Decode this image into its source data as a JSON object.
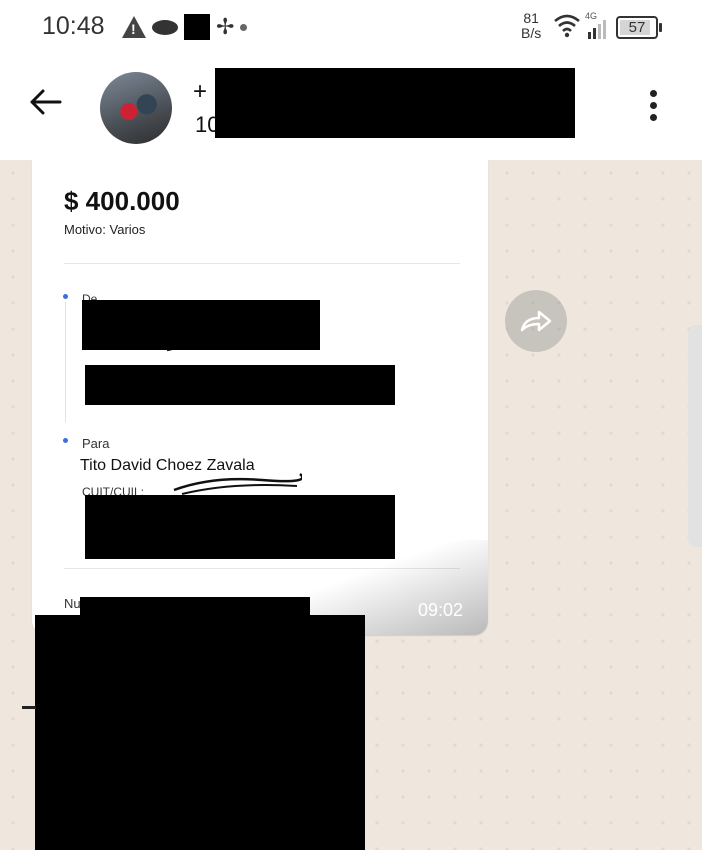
{
  "status_bar": {
    "time": "10:48",
    "net_speed_value": "81",
    "net_speed_unit": "B/s",
    "network_type": "4G",
    "battery": "57",
    "icons": [
      "warning-icon",
      "lips-icon",
      "black-square-icon",
      "fan-icon",
      "dot-icon",
      "wifi-icon",
      "signal-icon",
      "battery-icon"
    ]
  },
  "header": {
    "phone_prefix": "+",
    "second_line_prefix": "10",
    "icons": [
      "back-arrow-icon",
      "more-vertical-icon"
    ]
  },
  "message": {
    "amount": "$ 400.000",
    "reason": "Motivo: Varios",
    "from_label": "De",
    "to_label": "Para",
    "recipient_name": "Tito David Choez Zavala",
    "cuit_label": "CUIT/CUIL:",
    "footer_partial": "Nu",
    "time": "09:02"
  },
  "colors": {
    "chat_background": "#efe7dd",
    "bubble": "#ffffff",
    "accent_dot": "#3b6fe0"
  }
}
